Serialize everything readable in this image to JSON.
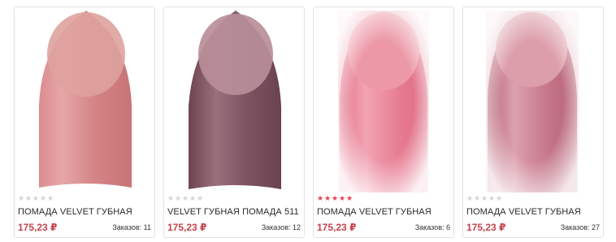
{
  "products": [
    {
      "title": "ПОМАДА VELVET ГУБНАЯ",
      "price": "175,23 ₽",
      "orders_label": "Заказов: 11",
      "rating": 0,
      "colors": {
        "tip": "#d99c98",
        "body": "#cf7f80",
        "shade": "#e4a8a6",
        "bg": "#ffffff"
      }
    },
    {
      "title": "VELVET ГУБНАЯ ПОМАДА 511",
      "price": "175,23 ₽",
      "orders_label": "Заказов: 12",
      "rating": 0,
      "colors": {
        "tip": "#b8909a",
        "body": "#7e5460",
        "shade": "#a07884",
        "bg": "#ffffff"
      }
    },
    {
      "title": "ПОМАДА VELVET ГУБНАЯ",
      "price": "175,23 ₽",
      "orders_label": "Заказов: 6",
      "rating": 5,
      "colors": {
        "tip": "#ea9aa8",
        "body": "#e8788e",
        "shade": "#f4b4c0",
        "bg": "#f2c4cc"
      }
    },
    {
      "title": "ПОМАДА VELVET ГУБНАЯ",
      "price": "175,23 ₽",
      "orders_label": "Заказов: 27",
      "rating": 0,
      "colors": {
        "tip": "#dc9aa6",
        "body": "#c47488",
        "shade": "#e0aab6",
        "bg": "#f0d0d6"
      }
    }
  ]
}
